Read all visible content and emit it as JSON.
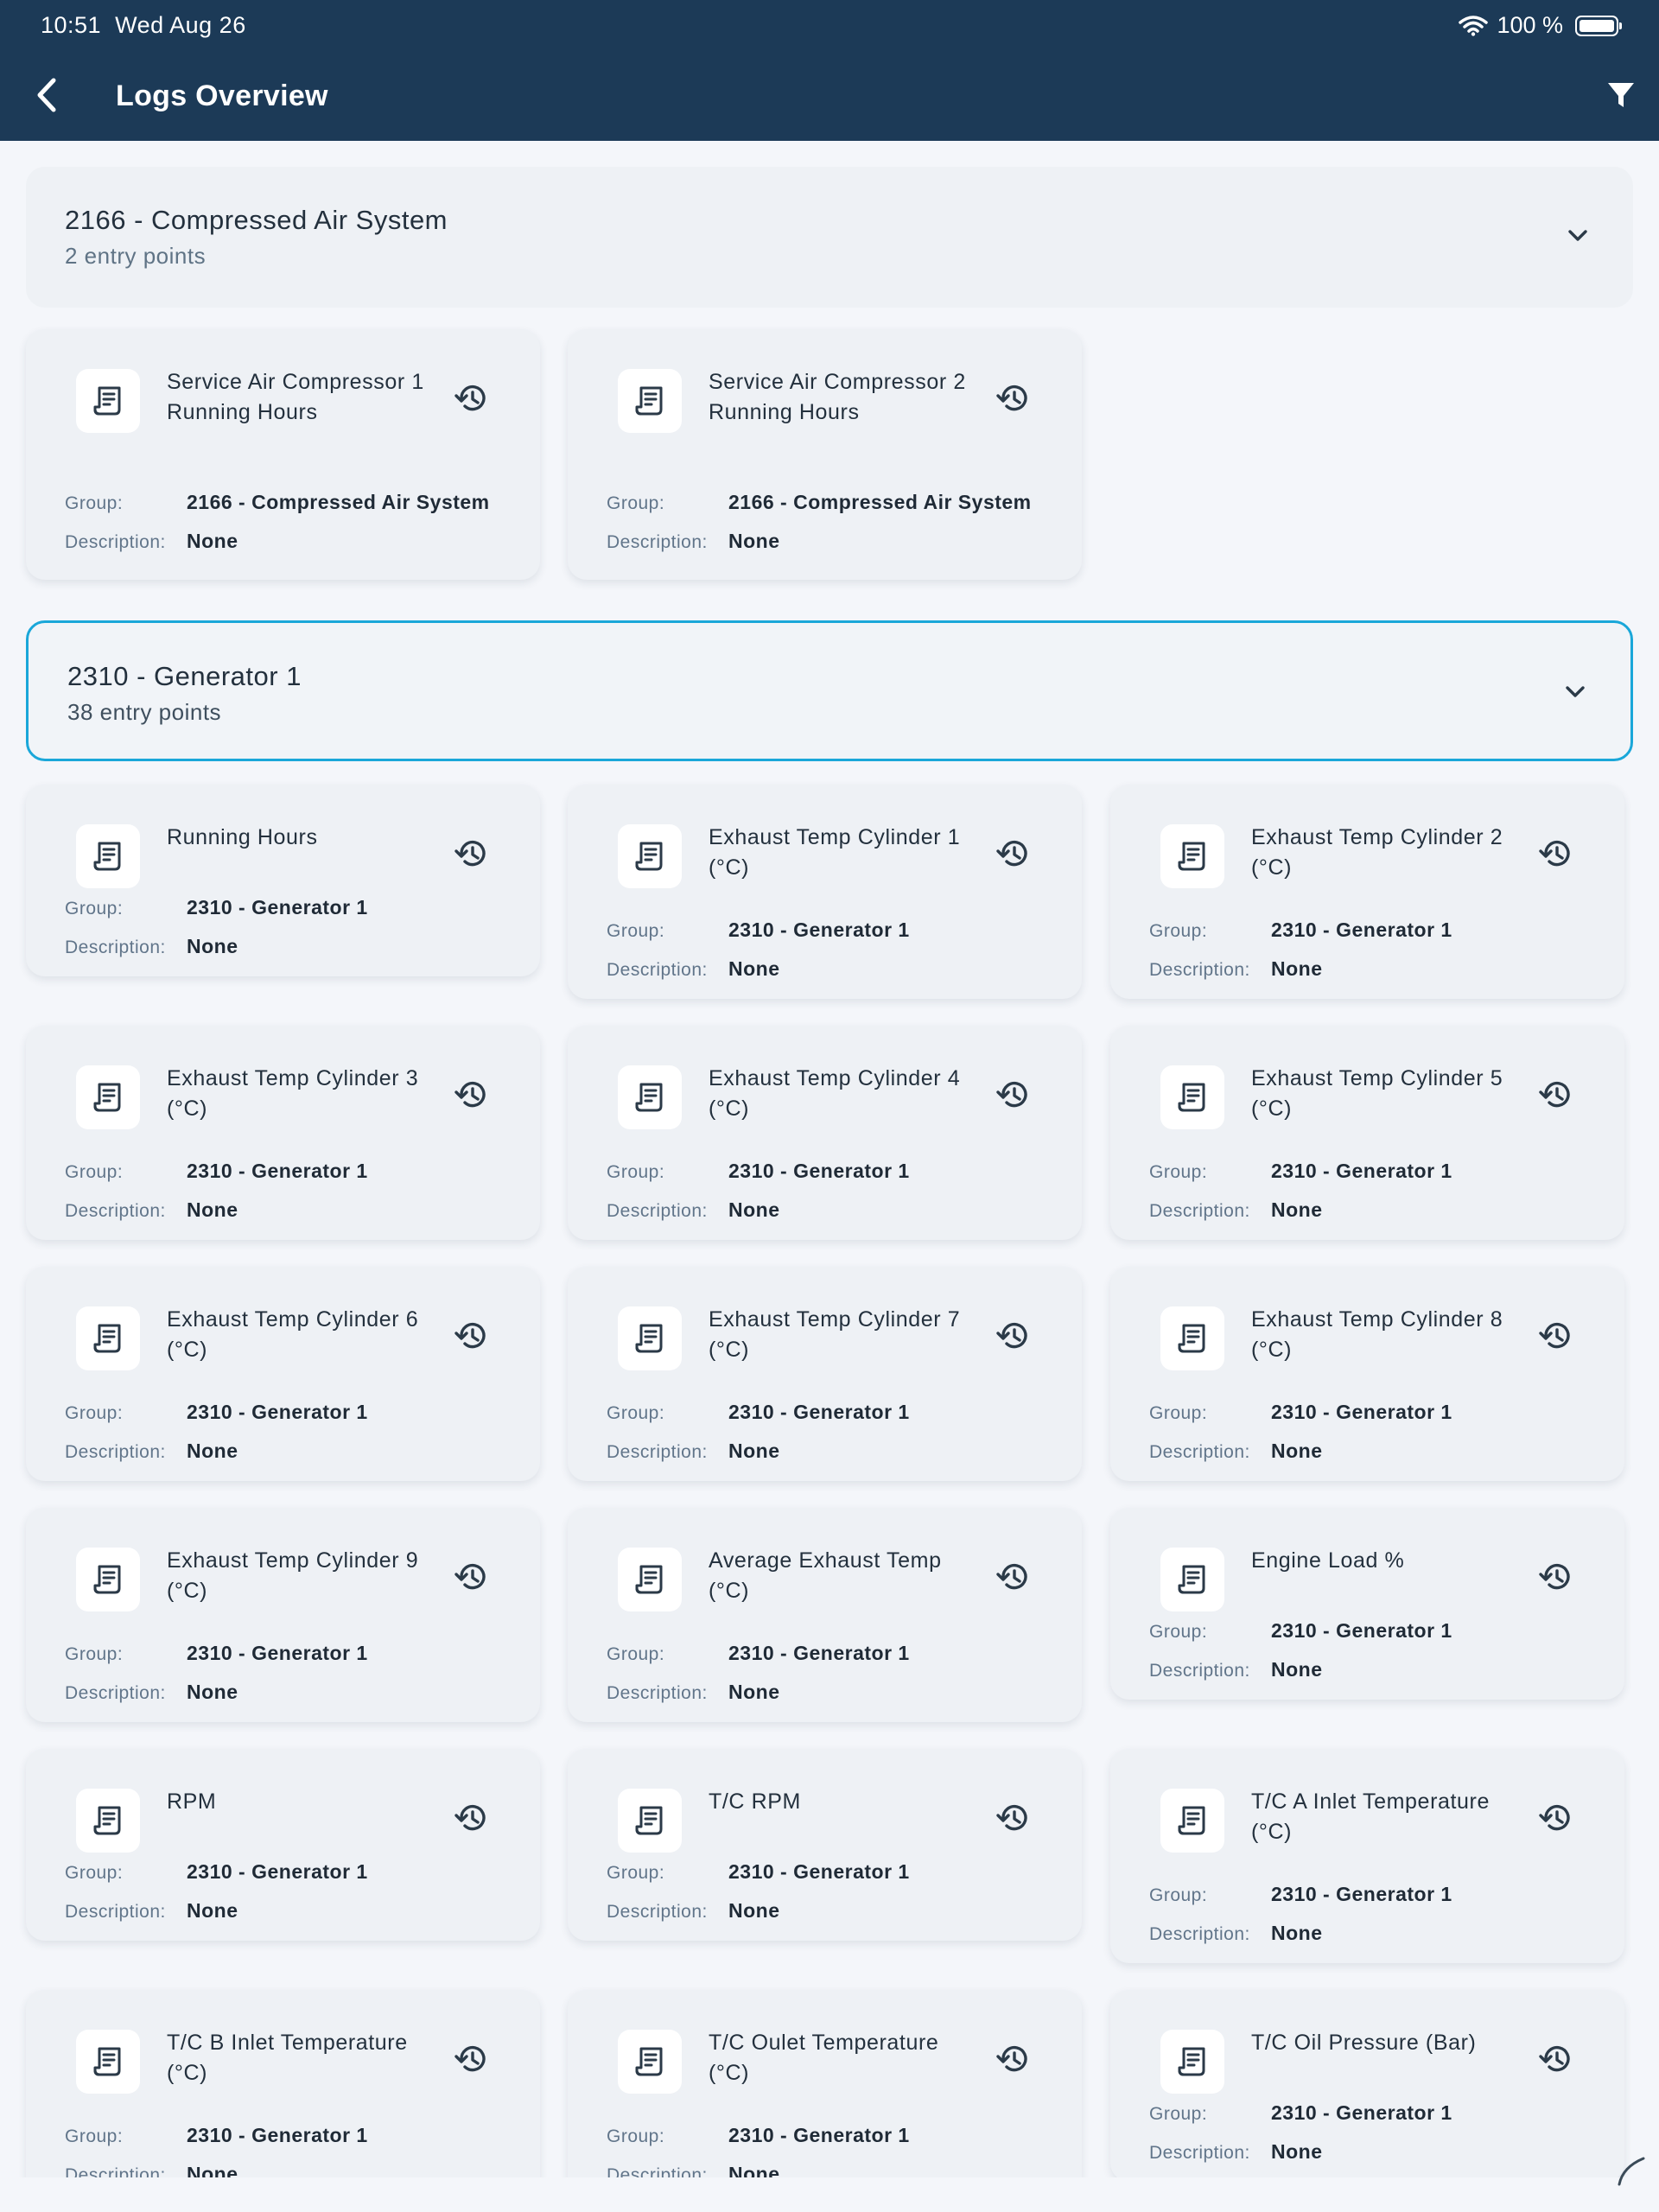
{
  "status": {
    "time": "10:51",
    "date": "Wed Aug 26",
    "battery": "100 %"
  },
  "header": {
    "title": "Logs Overview"
  },
  "meta_labels": {
    "group": "Group:",
    "description": "Description:"
  },
  "groups": [
    {
      "title": "2166 - Compressed Air System",
      "subtitle": "2 entry points",
      "cards": [
        {
          "title": "Service Air Compressor 1 Running Hours",
          "group": "2166 - Compressed Air System",
          "description": "None"
        },
        {
          "title": "Service Air Compressor 2 Running Hours",
          "group": "2166 - Compressed Air System",
          "description": "None"
        }
      ]
    },
    {
      "title": "2310 - Generator 1",
      "subtitle": "38 entry points",
      "cards": [
        {
          "title": "Running Hours",
          "group": "2310 - Generator 1",
          "description": "None"
        },
        {
          "title": "Exhaust Temp Cylinder 1  (°C)",
          "group": "2310 - Generator 1",
          "description": "None"
        },
        {
          "title": "Exhaust Temp Cylinder 2 (°C)",
          "group": "2310 - Generator 1",
          "description": "None"
        },
        {
          "title": "Exhaust Temp Cylinder 3 (°C)",
          "group": "2310 - Generator 1",
          "description": "None"
        },
        {
          "title": "Exhaust Temp Cylinder 4 (°C)",
          "group": "2310 - Generator 1",
          "description": "None"
        },
        {
          "title": "Exhaust Temp Cylinder 5 (°C)",
          "group": "2310 - Generator 1",
          "description": "None"
        },
        {
          "title": "Exhaust Temp Cylinder 6 (°C)",
          "group": "2310 - Generator 1",
          "description": "None"
        },
        {
          "title": "Exhaust Temp Cylinder 7 (°C)",
          "group": "2310 - Generator 1",
          "description": "None"
        },
        {
          "title": "Exhaust Temp Cylinder 8 (°C)",
          "group": "2310 - Generator 1",
          "description": "None"
        },
        {
          "title": "Exhaust Temp Cylinder 9 (°C)",
          "group": "2310 - Generator 1",
          "description": "None"
        },
        {
          "title": "Average Exhaust Temp (°C)",
          "group": "2310 - Generator 1",
          "description": "None"
        },
        {
          "title": "Engine Load %",
          "group": "2310 - Generator 1",
          "description": "None"
        },
        {
          "title": "RPM",
          "group": "2310 - Generator 1",
          "description": "None"
        },
        {
          "title": "T/C RPM",
          "group": "2310 - Generator 1",
          "description": "None"
        },
        {
          "title": "T/C A Inlet Temperature (°C)",
          "group": "2310 - Generator 1",
          "description": "None"
        },
        {
          "title": "T/C B Inlet Temperature (°C)",
          "group": "2310 - Generator 1",
          "description": "None"
        },
        {
          "title": "T/C Oulet Temperature (°C)",
          "group": "2310 - Generator 1",
          "description": "None"
        },
        {
          "title": "T/C Oil Pressure (Bar)",
          "group": "2310 - Generator 1",
          "description": "None"
        }
      ]
    }
  ],
  "icons": {
    "back": "chevron-left-icon",
    "filter": "filter-icon",
    "card": "log-document-icon",
    "history": "history-icon",
    "expand": "chevron-down-icon"
  },
  "colors": {
    "appbar": "#1c3a57",
    "selected_border": "#1aa7d9",
    "card_bg": "#eef1f5",
    "page_bg": "#f4f6fa"
  }
}
